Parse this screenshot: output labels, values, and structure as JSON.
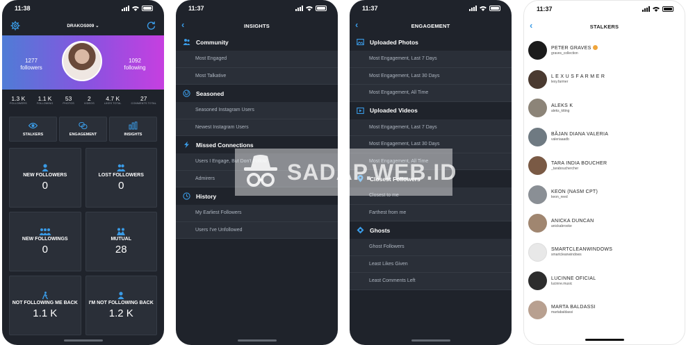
{
  "status": {
    "time1": "11:38",
    "time2": "11:37",
    "time3": "11:37",
    "time4": "11:37"
  },
  "dashboard": {
    "username": "DRAKOS009 ⌄",
    "followers_value": "1277",
    "followers_label": "followers",
    "following_value": "1092",
    "following_label": "following",
    "stats": [
      {
        "value": "1.3 K",
        "label": "FOLLOWERS"
      },
      {
        "value": "1.1 K",
        "label": "FOLLOWING"
      },
      {
        "value": "53",
        "label": "PHOTOS"
      },
      {
        "value": "2",
        "label": "VIDEOS"
      },
      {
        "value": "4.7 K",
        "label": "LIKES TOTAL"
      },
      {
        "value": "27",
        "label": "COMMENTS TOTAL"
      }
    ],
    "tabs": [
      "STALKERS",
      "ENGAGEMENT",
      "INSIGHTS"
    ],
    "cards": [
      {
        "title": "NEW FOLLOWERS",
        "value": "0"
      },
      {
        "title": "LOST FOLLOWERS",
        "value": "0"
      },
      {
        "title": "NEW FOLLOWINGS",
        "value": "0"
      },
      {
        "title": "MUTUAL",
        "value": "28"
      },
      {
        "title": "NOT FOLLOWING ME BACK",
        "value": "1.1 K"
      },
      {
        "title": "I'M NOT FOLLOWING BACK",
        "value": "1.2 K"
      }
    ]
  },
  "insights": {
    "title": "INSIGHTS",
    "sections": [
      {
        "label": "Community",
        "rows": [
          "Most Engaged",
          "Most Talkative"
        ]
      },
      {
        "label": "Seasoned",
        "rows": [
          "Seasoned Instagram Users",
          "Newest Instagram Users"
        ]
      },
      {
        "label": "Missed Connections",
        "rows": [
          "Users I Engage, But Don't Follow",
          "Admirers"
        ]
      },
      {
        "label": "History",
        "rows": [
          "My Earliest Followers",
          "Users I've Unfollowed"
        ]
      }
    ]
  },
  "engagement": {
    "title": "ENGAGEMENT",
    "sections": [
      {
        "label": "Uploaded Photos",
        "rows": [
          "Most Engagement, Last 7 Days",
          "Most Engagement, Last 30 Days",
          "Most Engagement, All Time"
        ]
      },
      {
        "label": "Uploaded Videos",
        "rows": [
          "Most Engagement, Last 7 Days",
          "Most Engagement, Last 30 Days",
          "Most Engagement, All Time"
        ]
      },
      {
        "label": "Closest Followers",
        "rows": [
          "Closest to me",
          "Farthest from me"
        ]
      },
      {
        "label": "Ghosts",
        "rows": [
          "Ghost Followers",
          "Least Likes Given",
          "Least Comments Left"
        ]
      }
    ]
  },
  "stalkers": {
    "title": "STALKERS",
    "users": [
      {
        "name": "PETER GRAVES",
        "handle": "graves_collection",
        "color": "#1b1b1b"
      },
      {
        "name": "L E X U S   F A R M E R",
        "handle": "lexy.farmer",
        "color": "#4a3a30"
      },
      {
        "name": "ALEKS K",
        "handle": "aleks_ktting",
        "color": "#8c8478"
      },
      {
        "name": "BĂJAN DIANA VALERIA",
        "handle": "valeriaaadb",
        "color": "#6f7a82"
      },
      {
        "name": "TARA INDIA BOUCHER",
        "handle": "_tarabouchercher",
        "color": "#7a5a45"
      },
      {
        "name": "KEON (NASM CPT)",
        "handle": "keon_reed",
        "color": "#8a8f95"
      },
      {
        "name": "ANICKA DUNCAN",
        "handle": "anickabrooke",
        "color": "#a08670"
      },
      {
        "name": "SMARTCLEANWINDOWS",
        "handle": "smartcleanwindows",
        "color": "#e8e8e8"
      },
      {
        "name": "LUCINNE OFICIAL",
        "handle": "lucinne.music",
        "color": "#2d2d2d"
      },
      {
        "name": "MARTA BALDASSI",
        "handle": "martabaldassi",
        "color": "#b8a090"
      }
    ]
  },
  "watermark": {
    "text": "SADAP.WEB.ID"
  },
  "colors": {
    "accent": "#3a9be6",
    "panel": "#1f232b",
    "row": "#2a2f38"
  }
}
